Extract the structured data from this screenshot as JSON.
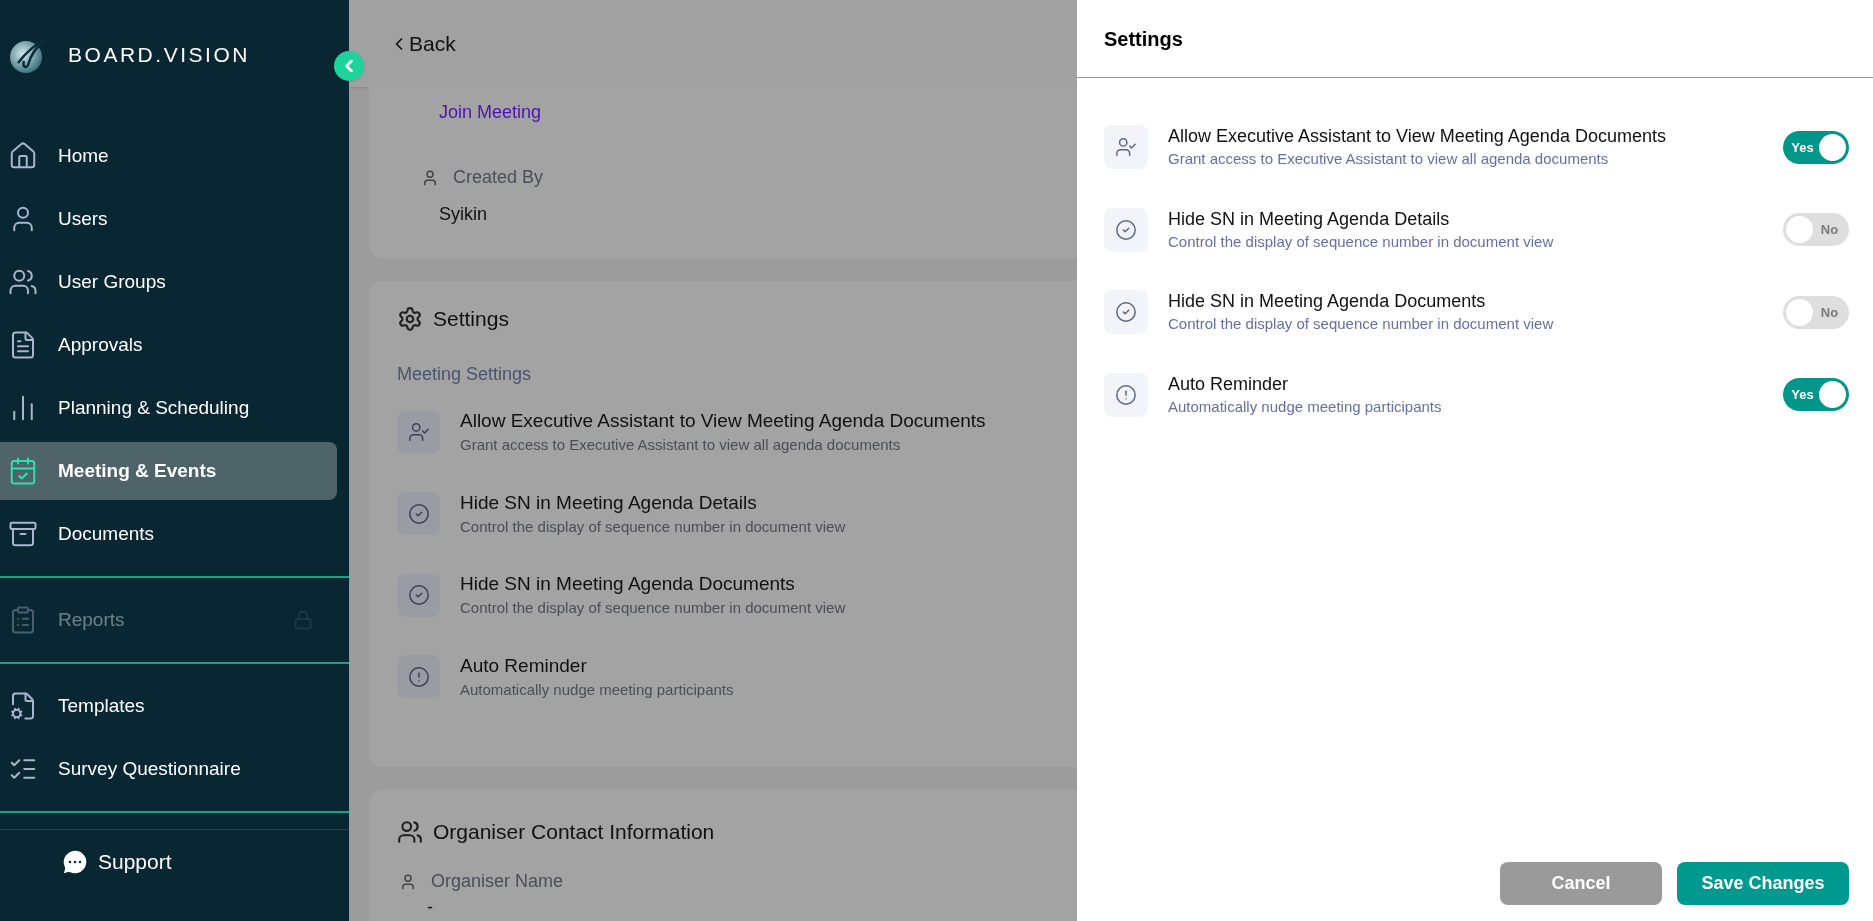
{
  "brand": "BOARD.VISION",
  "sidebar": {
    "sections": [
      [
        {
          "label": "Home",
          "selected": false,
          "disabled": false,
          "locked": false
        },
        {
          "label": "Users",
          "selected": false,
          "disabled": false,
          "locked": false
        },
        {
          "label": "User Groups",
          "selected": false,
          "disabled": false,
          "locked": false
        },
        {
          "label": "Approvals",
          "selected": false,
          "disabled": false,
          "locked": false
        },
        {
          "label": "Planning & Scheduling",
          "selected": false,
          "disabled": false,
          "locked": false
        },
        {
          "label": "Meeting & Events",
          "selected": true,
          "disabled": false,
          "locked": false
        },
        {
          "label": "Documents",
          "selected": false,
          "disabled": false,
          "locked": false
        }
      ],
      [
        {
          "label": "Reports",
          "selected": false,
          "disabled": true,
          "locked": true
        }
      ],
      [
        {
          "label": "Templates",
          "selected": false,
          "disabled": false,
          "locked": false
        },
        {
          "label": "Survey Questionnaire",
          "selected": false,
          "disabled": false,
          "locked": false
        }
      ]
    ],
    "support": "Support"
  },
  "main": {
    "back": "Back",
    "details": {
      "join_link": "Join Meeting",
      "created_by": {
        "label": "Created By",
        "value": "Syikin"
      }
    },
    "settings_card": {
      "title": "Settings",
      "subtitle": "Meeting Settings",
      "items": [
        {
          "title": "Allow Executive Assistant to View Meeting Agenda Documents",
          "description": "Grant access to Executive Assistant to view all agenda documents"
        },
        {
          "title": "Hide SN in Meeting Agenda Details",
          "description": "Control the display of sequence number in document view"
        },
        {
          "title": "Hide SN in Meeting Agenda Documents",
          "description": "Control the display of sequence number in document view"
        },
        {
          "title": "Auto Reminder",
          "description": "Automatically nudge meeting participants"
        }
      ]
    },
    "organiser_card": {
      "title": "Organiser Contact Information",
      "field": {
        "label": "Organiser Name",
        "value": "-"
      }
    }
  },
  "drawer": {
    "title": "Settings",
    "items": [
      {
        "title": "Allow Executive Assistant to View Meeting Agenda Documents",
        "description": "Grant access to Executive Assistant to view all agenda documents",
        "on": true,
        "toggle_text": "Yes"
      },
      {
        "title": "Hide SN in Meeting Agenda Details",
        "description": "Control the display of sequence number in document view",
        "on": false,
        "toggle_text": "No"
      },
      {
        "title": "Hide SN in Meeting Agenda Documents",
        "description": "Control the display of sequence number in document view",
        "on": false,
        "toggle_text": "No"
      },
      {
        "title": "Auto Reminder",
        "description": "Automatically nudge meeting participants",
        "on": true,
        "toggle_text": "Yes"
      }
    ],
    "buttons": {
      "cancel": "Cancel",
      "save": "Save Changes"
    }
  }
}
